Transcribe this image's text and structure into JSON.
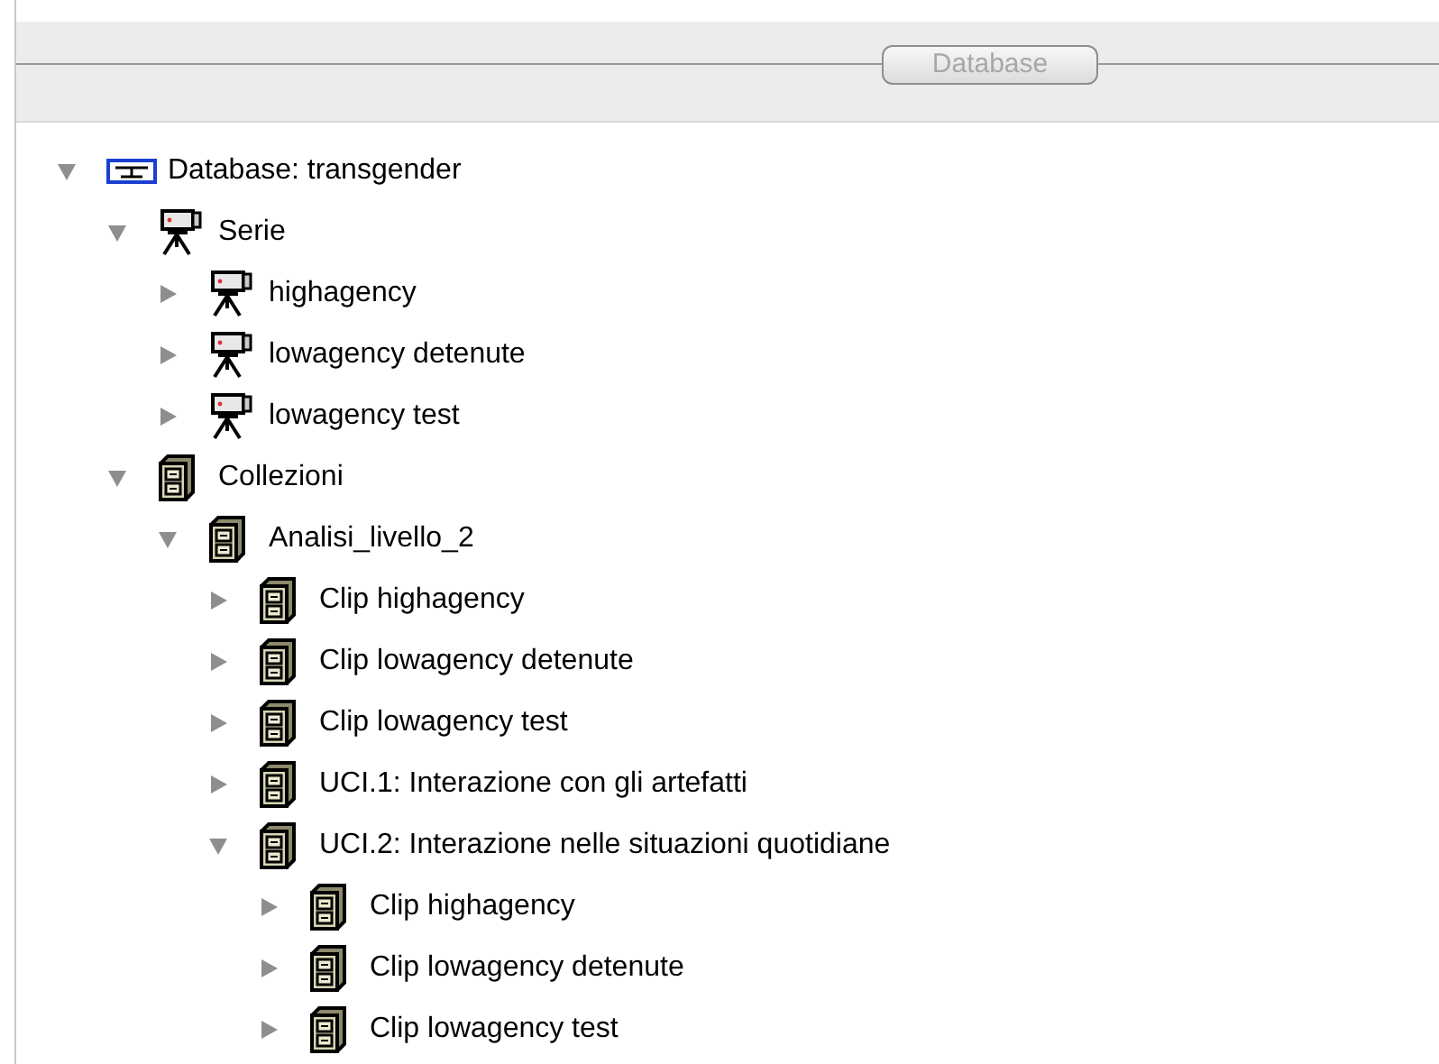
{
  "toolbar": {
    "button": "Database"
  },
  "tree": [
    {
      "label": "Database: transgender",
      "kind": "database",
      "expanded": true,
      "children": [
        {
          "label": "Serie",
          "kind": "camera",
          "expanded": true,
          "children": [
            {
              "label": "highagency",
              "kind": "camera",
              "expanded": false
            },
            {
              "label": "lowagency detenute",
              "kind": "camera",
              "expanded": false
            },
            {
              "label": "lowagency test",
              "kind": "camera",
              "expanded": false
            }
          ]
        },
        {
          "label": "Collezioni",
          "kind": "cabinet",
          "expanded": true,
          "children": [
            {
              "label": "Analisi_livello_2",
              "kind": "cabinet",
              "expanded": true,
              "children": [
                {
                  "label": "Clip highagency",
                  "kind": "cabinet",
                  "expanded": false
                },
                {
                  "label": "Clip lowagency detenute",
                  "kind": "cabinet",
                  "expanded": false
                },
                {
                  "label": "Clip lowagency test",
                  "kind": "cabinet",
                  "expanded": false
                },
                {
                  "label": "UCI.1: Interazione con gli artefatti",
                  "kind": "cabinet",
                  "expanded": false
                },
                {
                  "label": "UCI.2: Interazione nelle situazioni quotidiane",
                  "kind": "cabinet",
                  "expanded": true,
                  "children": [
                    {
                      "label": "Clip highagency",
                      "kind": "cabinet",
                      "expanded": false
                    },
                    {
                      "label": "Clip lowagency detenute",
                      "kind": "cabinet",
                      "expanded": false
                    },
                    {
                      "label": "Clip lowagency test",
                      "kind": "cabinet",
                      "expanded": false
                    }
                  ]
                }
              ]
            }
          ]
        }
      ]
    }
  ]
}
